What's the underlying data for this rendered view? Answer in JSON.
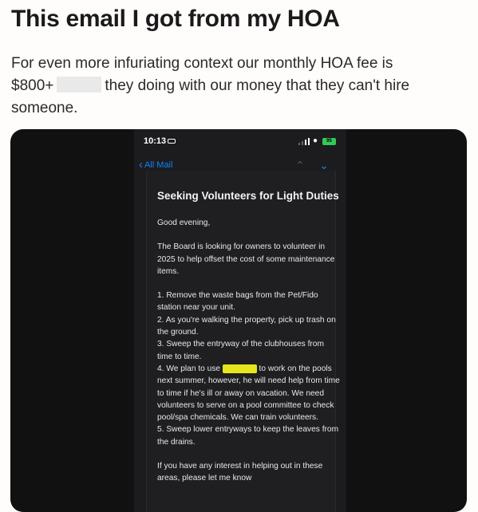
{
  "post": {
    "title": "This email I got from my HOA",
    "body_line1": "For even more infuriating context our monthly HOA fee is",
    "body_line2a": "$800+",
    "body_line2b": "they doing with our money that they can't hire",
    "body_line3": "someone."
  },
  "phone": {
    "status": {
      "time": "10:13",
      "battery": "95"
    },
    "nav": {
      "back_label": "All Mail"
    },
    "email": {
      "subject": "Seeking Volunteers for Light Duties",
      "greeting": "Good evening,",
      "intro": "The Board is looking for owners to volunteer in 2025 to help offset the cost of some maintenance items.",
      "item1": "1. Remove the waste bags from the Pet/Fido station near your unit.",
      "item2": "2. As you're walking the property, pick up trash on the ground.",
      "item3": "3. Sweep the entryway of the clubhouses from time to time.",
      "item4a": "4. We plan to use",
      "item4b": "to work on the pools next summer, however, he will need help from time to time if he's ill or away on vacation. We need volunteers to serve on a pool committee to check pool/spa chemicals. We can train volunteers.",
      "item5": "5. Sweep lower entryways to keep the leaves from the drains.",
      "closing": "If you have any interest in helping out in these areas, please let me know"
    }
  }
}
